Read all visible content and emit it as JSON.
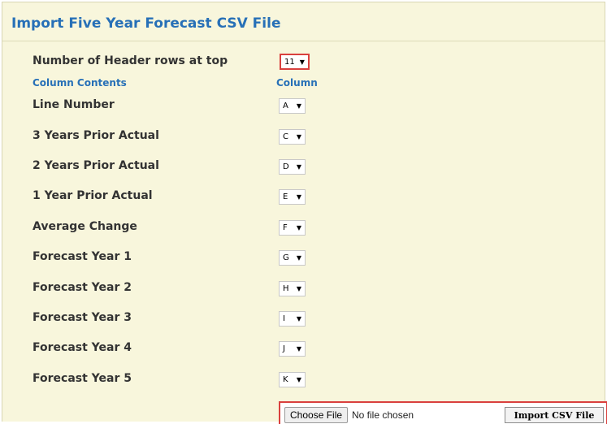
{
  "title": "Import Five Year Forecast CSV File",
  "header_rows": {
    "label": "Number of Header rows at top",
    "value": "11"
  },
  "columns_header": {
    "contents": "Column Contents",
    "column": "Column"
  },
  "fields": [
    {
      "label": "Line Number",
      "value": "A"
    },
    {
      "label": "3 Years Prior Actual",
      "value": "C"
    },
    {
      "label": "2 Years Prior Actual",
      "value": "D"
    },
    {
      "label": "1 Year Prior Actual",
      "value": "E"
    },
    {
      "label": "Average Change",
      "value": "F"
    },
    {
      "label": "Forecast Year 1",
      "value": "G"
    },
    {
      "label": "Forecast Year 2",
      "value": "H"
    },
    {
      "label": "Forecast Year 3",
      "value": "I"
    },
    {
      "label": "Forecast Year 4",
      "value": "J"
    },
    {
      "label": "Forecast Year 5",
      "value": "K"
    }
  ],
  "file_input": {
    "button_label": "Choose File",
    "status": "No file chosen"
  },
  "import_button": "Import CSV File",
  "icons": {
    "dropdown": "triangle-down-icon"
  },
  "colors": {
    "heading": "#2770b7",
    "highlight": "#d9403e",
    "panel_bg": "#f8f6dc"
  }
}
